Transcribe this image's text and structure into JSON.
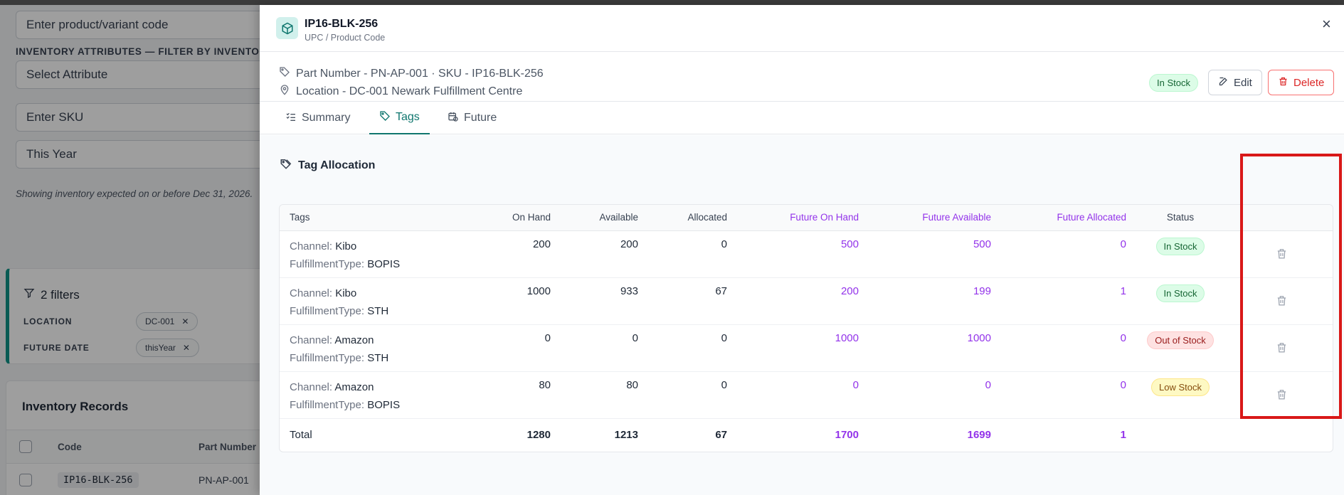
{
  "left_page": {
    "code_input_placeholder": "Enter product/variant code",
    "attributes_label": "INVENTORY ATTRIBUTES — FILTER BY INVENTORY",
    "attribute_select_value": "Select Attribute",
    "sku_placeholder": "Enter SKU",
    "date_select_value": "This Year",
    "date_note": "Showing inventory expected on or before Dec 31, 2026.",
    "filters": {
      "title": "2 filters",
      "items": [
        {
          "label": "LOCATION",
          "chip": "DC-001"
        },
        {
          "label": "FUTURE DATE",
          "chip": "thisYear"
        }
      ]
    },
    "records": {
      "title": "Inventory Records",
      "columns": [
        "Code",
        "Part Number"
      ],
      "rows": [
        {
          "code": "IP16-BLK-256",
          "part_number": "PN-AP-001"
        }
      ]
    }
  },
  "drawer": {
    "title": "IP16-BLK-256",
    "subtitle": "UPC / Product Code",
    "part_line": "Part Number - PN-AP-001 · SKU - IP16-BLK-256",
    "location_line": "Location - DC-001 Newark Fulfillment Centre",
    "status_badge": "In Stock",
    "edit_label": "Edit",
    "delete_label": "Delete",
    "close_glyph": "×",
    "tabs": [
      {
        "label": "Summary",
        "active": false
      },
      {
        "label": "Tags",
        "active": true
      },
      {
        "label": "Future",
        "active": false
      }
    ],
    "section_title": "Tag Allocation",
    "table": {
      "headers": [
        "Tags",
        "On Hand",
        "Available",
        "Allocated",
        "Future On Hand",
        "Future Available",
        "Future Allocated",
        "Status"
      ],
      "rows": [
        {
          "channel_key": "Channel:",
          "channel": "Kibo",
          "type_key": "FulfillmentType:",
          "type": "BOPIS",
          "on_hand": "200",
          "available": "200",
          "allocated": "0",
          "future_on_hand": "500",
          "future_available": "500",
          "future_allocated": "0",
          "status": "In Stock",
          "status_kind": "green"
        },
        {
          "channel_key": "Channel:",
          "channel": "Kibo",
          "type_key": "FulfillmentType:",
          "type": "STH",
          "on_hand": "1000",
          "available": "933",
          "allocated": "67",
          "future_on_hand": "200",
          "future_available": "199",
          "future_allocated": "1",
          "status": "In Stock",
          "status_kind": "green"
        },
        {
          "channel_key": "Channel:",
          "channel": "Amazon",
          "type_key": "FulfillmentType:",
          "type": "STH",
          "on_hand": "0",
          "available": "0",
          "allocated": "0",
          "future_on_hand": "1000",
          "future_available": "1000",
          "future_allocated": "0",
          "status": "Out of Stock",
          "status_kind": "red"
        },
        {
          "channel_key": "Channel:",
          "channel": "Amazon",
          "type_key": "FulfillmentType:",
          "type": "BOPIS",
          "on_hand": "80",
          "available": "80",
          "allocated": "0",
          "future_on_hand": "0",
          "future_available": "0",
          "future_allocated": "0",
          "status": "Low Stock",
          "status_kind": "yellow"
        }
      ],
      "total": {
        "label": "Total",
        "on_hand": "1280",
        "available": "1213",
        "allocated": "67",
        "future_on_hand": "1700",
        "future_available": "1699",
        "future_allocated": "1"
      }
    }
  },
  "colors": {
    "accent": "#0f766e",
    "future": "#9333ea",
    "danger": "#dc2626",
    "highlight": "#d91818"
  }
}
